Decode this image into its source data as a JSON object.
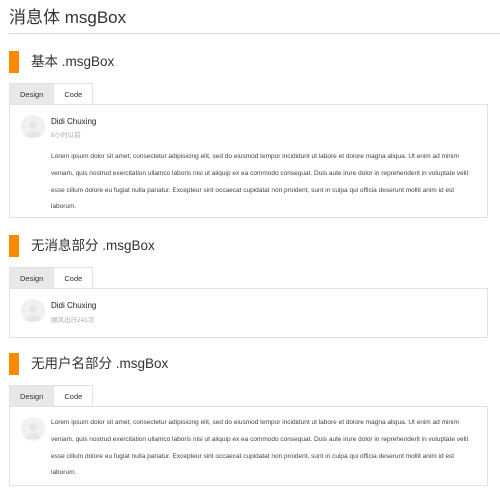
{
  "page": {
    "title": "消息体 msgBox"
  },
  "sections": [
    {
      "title": "基本 .msgBox",
      "tabs": [
        "Design",
        "Code"
      ],
      "msg": {
        "name": "Didi Chuxing",
        "meta": "8小时以前",
        "body": "Lorem ipsum dolor sit amet, consectetur adipisicing elit, sed do eiusmod tempor incididunt ut labore et dolore magna aliqua. Ut enim ad minim veniam, quis nostrud exercitation ullamco laboris nisi ut aliquip ex ea commodo consequat. Duis aute irure dolor in reprehenderit in voluptate velit esse cillum dolore eu fugiat nulla pariatur. Excepteur sint occaecat cupidatat non proident, sunt in culpa qui officia deserunt mollit anim id est laborum."
      }
    },
    {
      "title": "无消息部分 .msgBox",
      "tabs": [
        "Design",
        "Code"
      ],
      "msg": {
        "name": "Didi Chuxing",
        "meta": "顺风出行241次"
      }
    },
    {
      "title": "无用户名部分 .msgBox",
      "tabs": [
        "Design",
        "Code"
      ],
      "msg": {
        "body": "Lorem ipsum dolor sit amet, consectetur adipisicing elit, sed do eiusmod tempor incididunt ut labore et dolore magna aliqua. Ut enim ad minim veniam, quis nostrud exercitation ullamco laboris nisi ut aliquip ex ea commodo consequat. Duis aute irure dolor in reprehenderit in voluptate velit esse cillum dolore eu fugiat nulla pariatur. Excepteur sint occaecat cupidatat non proident, sunt in culpa qui officia deserunt mollit anim id est laborum."
      }
    }
  ],
  "colors": {
    "accent": "#ff8a00",
    "active_tab": "#e8e8e8",
    "border": "#e3e3e3"
  },
  "icons": {
    "avatar": "user-avatar-icon"
  }
}
